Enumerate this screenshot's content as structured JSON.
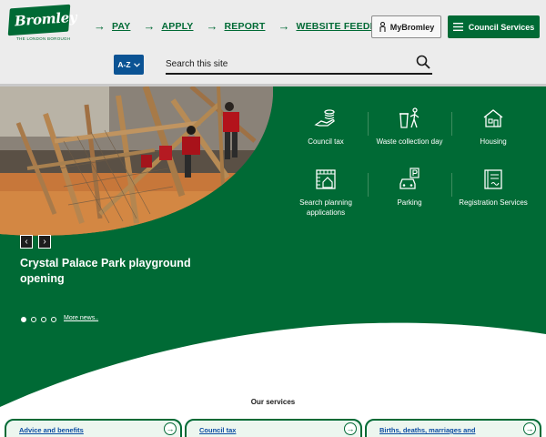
{
  "logo": {
    "name": "Bromley",
    "subtitle": "THE LONDON BOROUGH"
  },
  "topnav": [
    {
      "label": "PAY"
    },
    {
      "label": "APPLY"
    },
    {
      "label": "REPORT"
    },
    {
      "label": "WEBSITE FEEDBACK"
    }
  ],
  "account": {
    "mybromley_label": "MyBromley",
    "council_services_label": "Council Services"
  },
  "az": {
    "label": "A-Z"
  },
  "search": {
    "placeholder": "Search this site",
    "value": ""
  },
  "hero": {
    "prev_glyph": "‹",
    "next_glyph": "›",
    "slide_title": "Crystal Palace Park playground opening",
    "dots": [
      true,
      false,
      false,
      false
    ],
    "more_news": "More news.."
  },
  "quick_links": [
    {
      "label": "Council tax",
      "icon": "hand-coins-icon"
    },
    {
      "label": "Waste collection day",
      "icon": "recycle-bin-icon"
    },
    {
      "label": "Housing",
      "icon": "house-icon"
    },
    {
      "label": "Search planning applications",
      "icon": "planning-icon"
    },
    {
      "label": "Parking",
      "icon": "parking-icon"
    },
    {
      "label": "Registration Services",
      "icon": "registration-book-icon"
    }
  ],
  "services": {
    "title": "Our services",
    "cards": [
      {
        "label": "Advice and benefits"
      },
      {
        "label": "Council tax"
      },
      {
        "label": "Births, deaths, marriages and"
      }
    ]
  },
  "colors": {
    "brand_green": "#006a35",
    "az_blue": "#0b5394",
    "link_blue": "#0b4da2"
  }
}
